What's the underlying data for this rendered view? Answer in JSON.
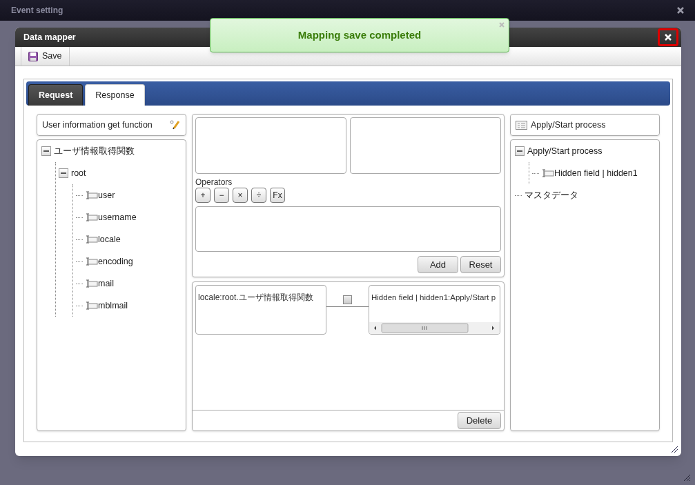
{
  "window": {
    "title": "Event setting"
  },
  "dialog": {
    "title": "Data mapper"
  },
  "toolbar": [
    {
      "label": "Save"
    }
  ],
  "tabs": [
    {
      "label": "Request",
      "selected": false
    },
    {
      "label": "Response",
      "selected": true
    }
  ],
  "source": {
    "header": "User information get function",
    "tree": [
      {
        "label": "ユーザ情報取得関数",
        "expanded": true,
        "children": [
          {
            "label": "root",
            "expanded": true,
            "children": [
              {
                "label": "user",
                "kind": "field"
              },
              {
                "label": "username",
                "kind": "field"
              },
              {
                "label": "locale",
                "kind": "field"
              },
              {
                "label": "encoding",
                "kind": "field"
              },
              {
                "label": "mail",
                "kind": "field"
              },
              {
                "label": "mblmail",
                "kind": "field"
              }
            ]
          }
        ]
      }
    ]
  },
  "operators": {
    "label": "Operators",
    "buttons": [
      "+",
      "−",
      "×",
      "÷",
      "Fx"
    ]
  },
  "expression_buttons": [
    "Add",
    "Reset"
  ],
  "mapping": {
    "source": "locale:root.ユーザ情報取得関数",
    "target": "Hidden field | hidden1:Apply/Start p",
    "checked": false
  },
  "delete_button": "Delete",
  "target": {
    "header": "Apply/Start process",
    "tree": [
      {
        "label": "Apply/Start process",
        "expanded": true,
        "children": [
          {
            "label": "Hidden field | hidden1",
            "kind": "field"
          }
        ]
      },
      {
        "label": "マスタデータ"
      }
    ]
  },
  "toast": {
    "message": "Mapping save completed"
  }
}
